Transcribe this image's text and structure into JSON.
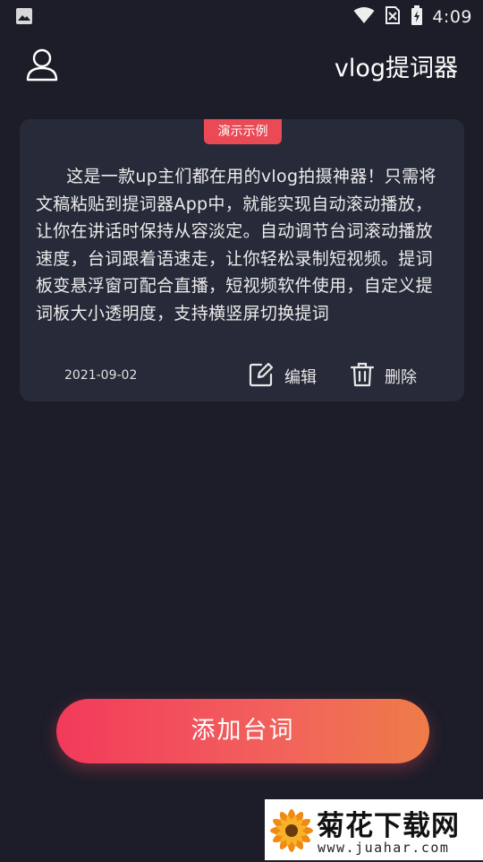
{
  "status_bar": {
    "time": "4:09"
  },
  "header": {
    "title": "vlog提词器"
  },
  "card": {
    "badge": "演示示例",
    "text": "这是一款up主们都在用的vlog拍摄神器！只需将文稿粘贴到提词器App中，就能实现自动滚动播放，让你在讲话时保持从容淡定。自动调节台词滚动播放速度，台词跟着语速走，让你轻松录制短视频。提词板变悬浮窗可配合直播，短视频软件使用，自定义提词板大小透明度，支持横竖屏切换提词",
    "date": "2021-09-02",
    "edit_label": "编辑",
    "delete_label": "删除"
  },
  "add_button": {
    "label": "添加台词"
  },
  "watermark": {
    "title": "菊花下载网",
    "url": "www.juahar.com"
  },
  "colors": {
    "background": "#1c1d29",
    "card": "#272a38",
    "badge": "#e94a55",
    "accent_start": "#f23a5b",
    "accent_end": "#ee7c48"
  },
  "icons": [
    "image-icon",
    "wifi-icon",
    "no-sim-icon",
    "battery-icon",
    "user-icon",
    "edit-icon",
    "trash-icon",
    "flower-icon"
  ]
}
